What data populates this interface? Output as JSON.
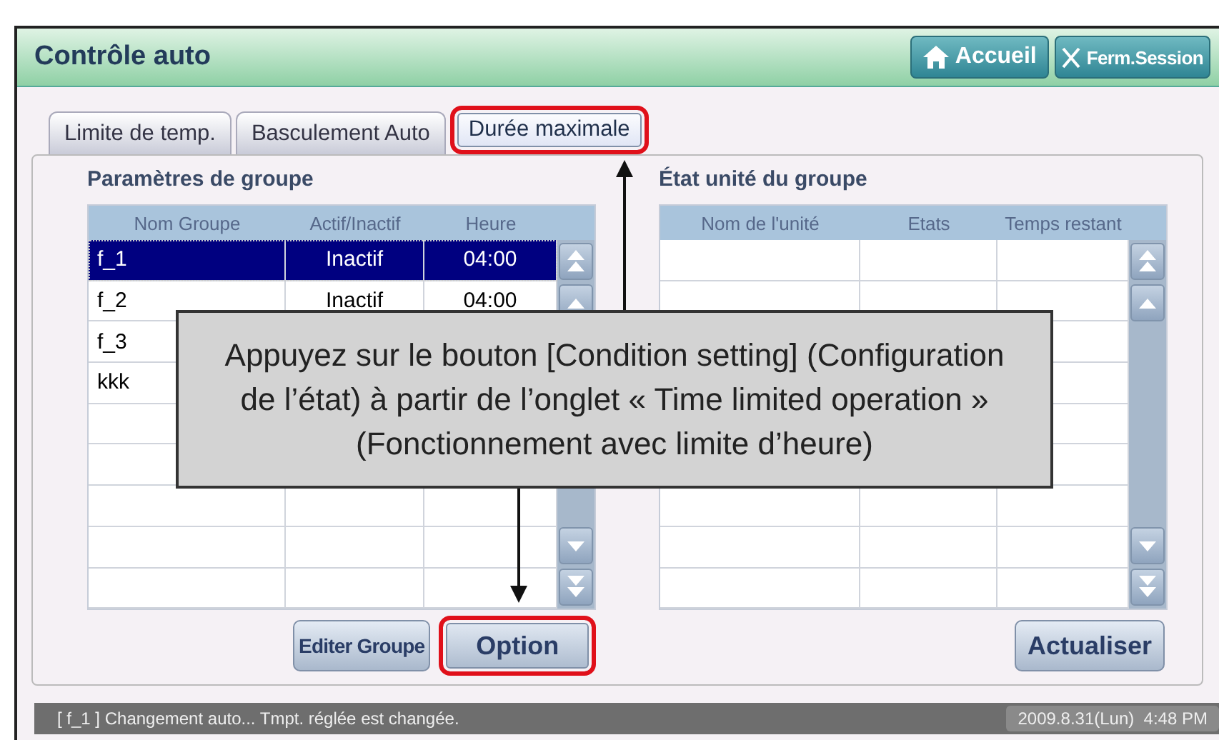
{
  "window": {
    "title": "Contrôle auto"
  },
  "header_buttons": [
    {
      "label": "Accueil",
      "kind": "home"
    },
    {
      "label": "Ferm.Session",
      "kind": "close"
    }
  ],
  "tabs": [
    {
      "label": "Limite de temp.",
      "selected": false,
      "highlighted": false
    },
    {
      "label": "Basculement Auto",
      "selected": false,
      "highlighted": false
    },
    {
      "label": "Durée maximale",
      "selected": true,
      "highlighted": true
    }
  ],
  "group_panel": {
    "title": "Paramètres de groupe",
    "columns": [
      "Nom Groupe",
      "Actif/Inactif",
      "Heure"
    ],
    "rows": [
      {
        "cells": [
          "f_1",
          "Inactif",
          "04:00"
        ],
        "selected": true
      },
      {
        "cells": [
          "f_2",
          "Inactif",
          "04:00"
        ],
        "selected": false
      },
      {
        "cells": [
          "f_3"
        ],
        "selected": false
      },
      {
        "cells": [
          "kkk"
        ],
        "selected": false
      }
    ]
  },
  "unit_panel": {
    "title": "État unité du groupe",
    "columns": [
      "Nom de l'unité",
      "Etats",
      "Temps restant"
    ]
  },
  "buttons": [
    {
      "label": "Editer Groupe",
      "highlighted": false
    },
    {
      "label": "Option",
      "highlighted": true
    },
    {
      "label": "Actualiser",
      "highlighted": false
    }
  ],
  "callout": {
    "text": "Appuyez sur le bouton [Condition setting] (Configuration de l’état) à partir de l’onglet « Time limited operation » (Fonctionnement avec limite d’heure)"
  },
  "status_bar": {
    "message": "[ f_1 ] Changement auto... Tmpt. réglée est changée.",
    "datetime": "2009.8.31(Lun)  4:48 PM"
  }
}
